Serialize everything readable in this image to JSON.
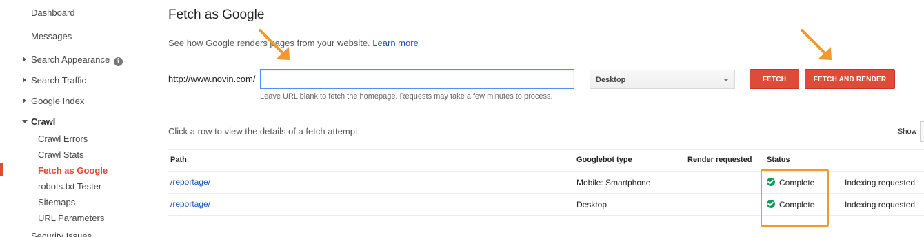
{
  "sidebar": {
    "items": [
      {
        "label": "Dashboard"
      },
      {
        "label": "Messages"
      },
      {
        "label": "Search Appearance"
      },
      {
        "label": "Search Traffic"
      },
      {
        "label": "Google Index"
      },
      {
        "label": "Crawl"
      }
    ],
    "crawl_sub": [
      {
        "label": "Crawl Errors"
      },
      {
        "label": "Crawl Stats"
      },
      {
        "label": "Fetch as Google"
      },
      {
        "label": "robots.txt Tester"
      },
      {
        "label": "Sitemaps"
      },
      {
        "label": "URL Parameters"
      }
    ],
    "next_item": "Security Issues",
    "info_glyph": "i"
  },
  "page": {
    "title": "Fetch as Google",
    "description": "See how Google renders pages from your website.",
    "learn_more": "Learn more"
  },
  "form": {
    "url_prefix": "http://www.novin.com/",
    "url_value": "",
    "hint": "Leave URL blank to fetch the homepage. Requests may take a few minutes to process.",
    "device": "Desktop",
    "fetch_label": "FETCH",
    "render_label": "FETCH AND RENDER"
  },
  "history": {
    "click_hint": "Click a row to view the details of a fetch attempt",
    "show_label": "Show",
    "columns": [
      "Path",
      "Googlebot type",
      "Render requested",
      "Status"
    ],
    "rows": [
      {
        "path": "/reportage/",
        "bot": "Mobile: Smartphone",
        "render": "",
        "status": "Complete",
        "extra": "Indexing requested"
      },
      {
        "path": "/reportage/",
        "bot": "Desktop",
        "render": "",
        "status": "Complete",
        "extra": "Indexing requested"
      }
    ]
  },
  "colors": {
    "accent": "#dd4b39",
    "link": "#1a55b8",
    "annotation": "#f09a2e",
    "success": "#0f9d58"
  },
  "icons": [
    "info-icon",
    "caret-right-icon",
    "caret-down-icon",
    "checkmark-icon",
    "dropdown-arrow-icon"
  ]
}
